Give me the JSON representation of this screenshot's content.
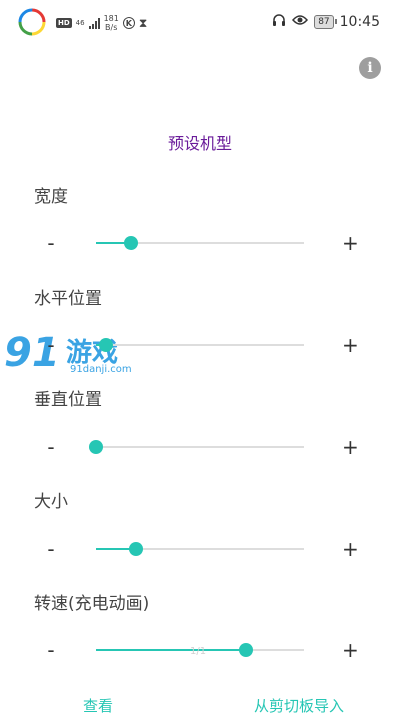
{
  "status_bar": {
    "hd_label": "HD",
    "network_label": "46",
    "speed_value": "181",
    "speed_unit": "B/s",
    "k_label": "K",
    "battery": "87",
    "time": "10:45"
  },
  "page": {
    "title": "预设机型"
  },
  "sliders": [
    {
      "label": "宽度",
      "value": 0.17
    },
    {
      "label": "水平位置",
      "value": 0.05
    },
    {
      "label": "垂直位置",
      "value": 0.0
    },
    {
      "label": "大小",
      "value": 0.19
    },
    {
      "label": "转速(充电动画)",
      "value": 0.72
    }
  ],
  "controls": {
    "minus": "-",
    "plus": "+"
  },
  "watermark": {
    "number": "91",
    "text": "游戏",
    "url": "91danji.com"
  },
  "ghost_text": "1/1",
  "bottom": {
    "left_button": "查看",
    "right_button": "从剪切板导入"
  },
  "colors": {
    "accent": "#26c6b4",
    "title": "#6a1b9a",
    "track": "#dddddd"
  }
}
